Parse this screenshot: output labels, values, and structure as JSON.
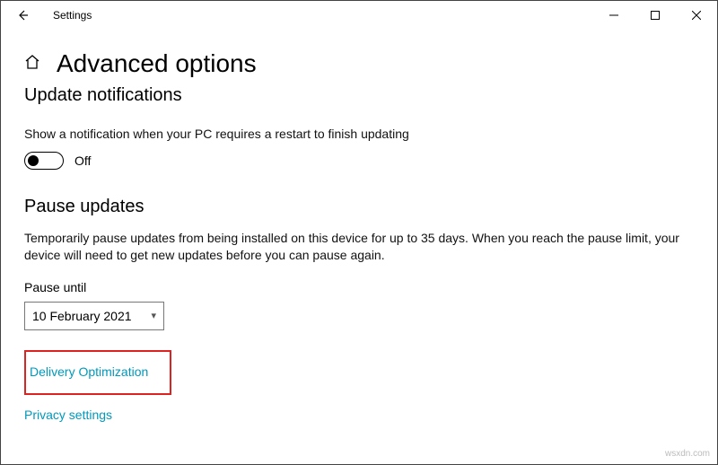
{
  "window": {
    "title": "Settings"
  },
  "page": {
    "title": "Advanced options"
  },
  "notifications": {
    "heading": "Update notifications",
    "description": "Show a notification when your PC requires a restart to finish updating",
    "toggle_state": "Off"
  },
  "pause": {
    "heading": "Pause updates",
    "description": "Temporarily pause updates from being installed on this device for up to 35 days. When you reach the pause limit, your device will need to get new updates before you can pause again.",
    "label": "Pause until",
    "selected_date": "10 February 2021"
  },
  "links": {
    "delivery_optimization": "Delivery Optimization",
    "privacy_settings": "Privacy settings"
  },
  "watermark": "wsxdn.com"
}
